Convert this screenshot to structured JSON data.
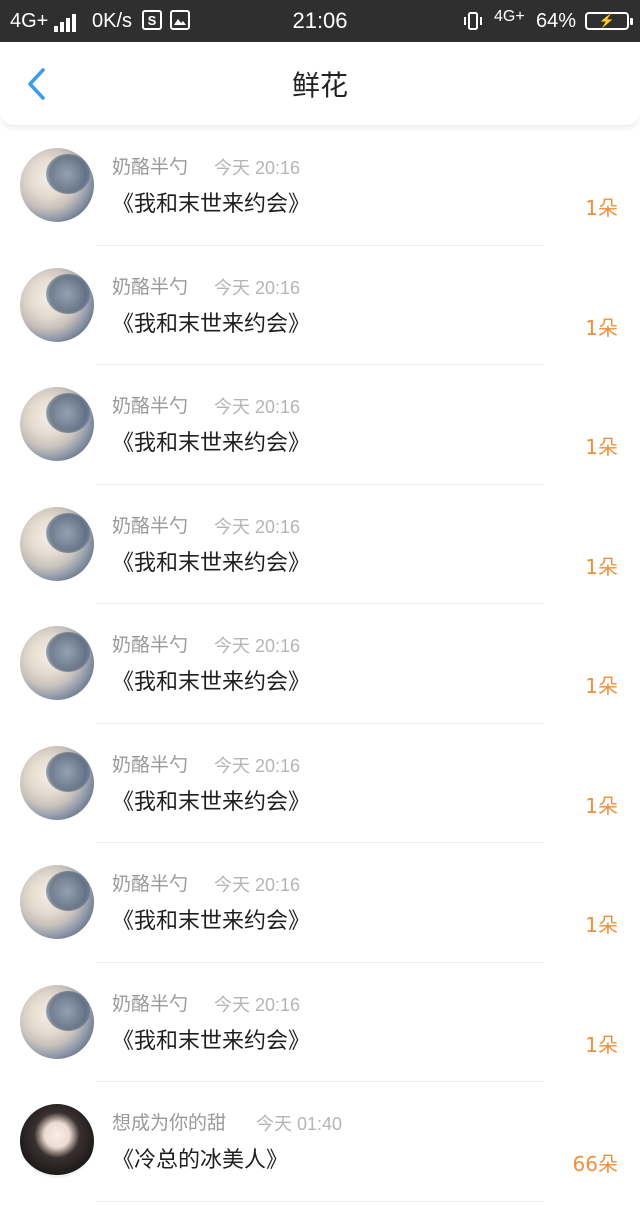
{
  "status_bar": {
    "network": "4G+",
    "speed": "0K/s",
    "app_icon_1": "S",
    "time": "21:06",
    "network_right": "4G+",
    "battery_percent": "64%",
    "icons": [
      "signal-icon",
      "s-app-icon",
      "gallery-icon",
      "vibrate-icon",
      "battery-charging-icon"
    ]
  },
  "header": {
    "title": "鲜花",
    "back_icon": "chevron-left-icon",
    "accent_color": "#3a9bf0"
  },
  "items": [
    {
      "user": "奶酪半勺",
      "time": "今天 20:16",
      "book": "《我和末世来约会》",
      "count": "1朵"
    },
    {
      "user": "奶酪半勺",
      "time": "今天 20:16",
      "book": "《我和末世来约会》",
      "count": "1朵"
    },
    {
      "user": "奶酪半勺",
      "time": "今天 20:16",
      "book": "《我和末世来约会》",
      "count": "1朵"
    },
    {
      "user": "奶酪半勺",
      "time": "今天 20:16",
      "book": "《我和末世来约会》",
      "count": "1朵"
    },
    {
      "user": "奶酪半勺",
      "time": "今天 20:16",
      "book": "《我和末世来约会》",
      "count": "1朵"
    },
    {
      "user": "奶酪半勺",
      "time": "今天 20:16",
      "book": "《我和末世来约会》",
      "count": "1朵"
    },
    {
      "user": "奶酪半勺",
      "time": "今天 20:16",
      "book": "《我和末世来约会》",
      "count": "1朵"
    },
    {
      "user": "奶酪半勺",
      "time": "今天 20:16",
      "book": "《我和末世来约会》",
      "count": "1朵"
    },
    {
      "user": "想成为你的甜",
      "time": "今天 01:40",
      "book": "《冷总的冰美人》",
      "count": "66朵"
    }
  ],
  "colors": {
    "count_color": "#f0903a",
    "status_bar_bg": "#2f2f2f"
  }
}
